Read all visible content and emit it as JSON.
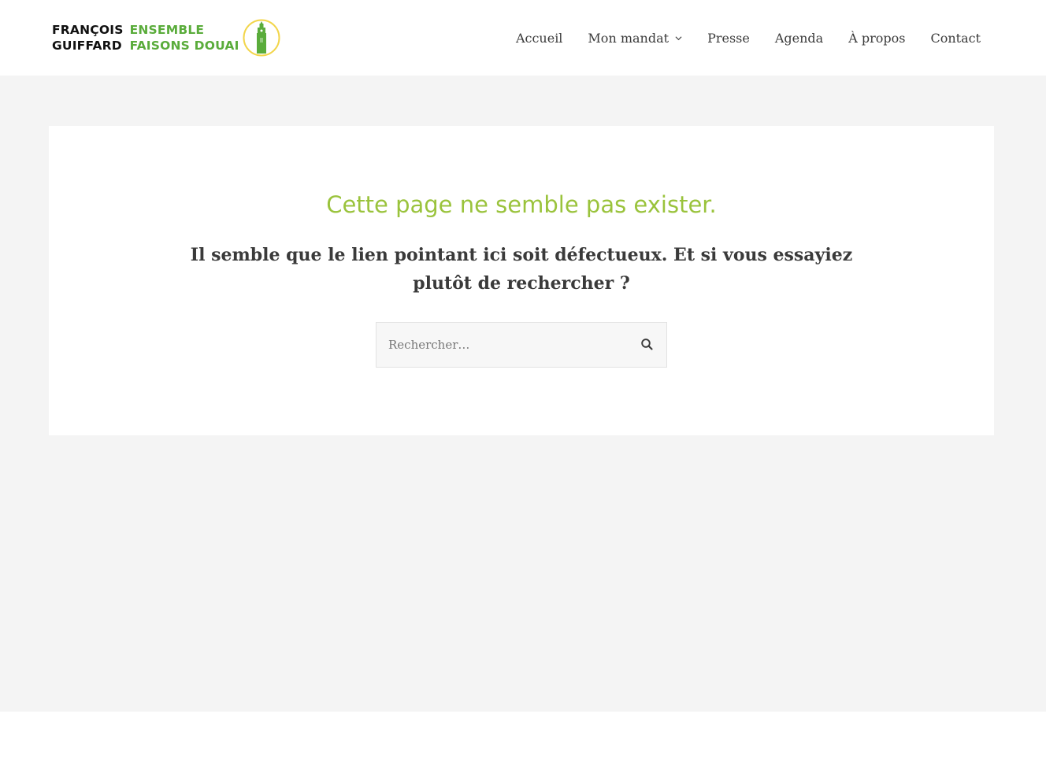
{
  "header": {
    "logo": {
      "name_line1": "FRANÇOIS",
      "name_line2": "GUIFFARD",
      "slogan_line1": "ENSEMBLE",
      "slogan_line2": "FAISONS DOUAI",
      "emblem_icon": "belfry-tower-icon",
      "colors": {
        "name": "#111111",
        "slogan": "#5aac3b",
        "emblem_ring": "#f2d54a",
        "emblem_tower": "#5aac3b"
      }
    },
    "nav": {
      "items": [
        {
          "label": "Accueil"
        },
        {
          "label": "Mon mandat",
          "has_submenu": true,
          "icon": "chevron-down-icon"
        },
        {
          "label": "Presse"
        },
        {
          "label": "Agenda"
        },
        {
          "label": "À propos"
        },
        {
          "label": "Contact"
        }
      ]
    }
  },
  "main": {
    "title": "Cette page ne semble pas exister.",
    "subtitle": "Il semble que le lien pointant ici soit défectueux. Et si vous essayiez plutôt de rechercher ?",
    "search": {
      "placeholder": "Rechercher…",
      "value": "",
      "button_icon": "search-icon"
    }
  },
  "colors": {
    "accent_title": "#9ac33c",
    "text": "#3a3a3a",
    "page_background": "#f4f4f4",
    "card_background": "#ffffff"
  }
}
